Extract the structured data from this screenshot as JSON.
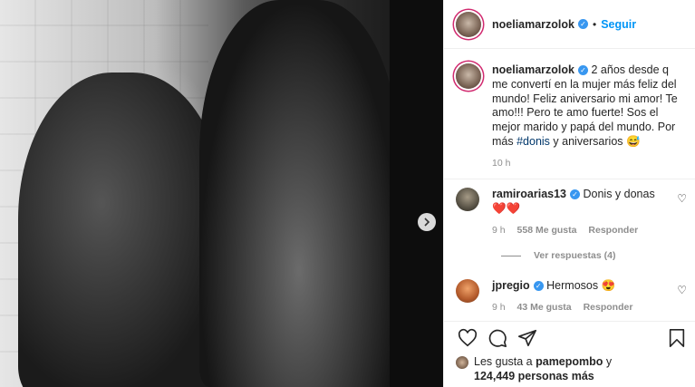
{
  "post": {
    "username": "noeliamarzolok",
    "follow_label": "Seguir",
    "caption_text": "2 años desde q me convertí en la mujer más feliz del mundo! Feliz aniversario mi amor! Te amo!!! Pero te amo fuerte! Sos el mejor marido y papá del mundo. Por más ",
    "caption_hashtag": "#donis",
    "caption_tail": " y aniversarios 😅",
    "time": "10 h"
  },
  "comments": [
    {
      "username": "ramiroarias13",
      "text": "Donis y donas ❤️❤️",
      "time": "9 h",
      "likes": "558 Me gusta",
      "reply_label": "Responder",
      "view_replies": "Ver respuestas (4)"
    },
    {
      "username": "jpregio",
      "text": "Hermosos 😍",
      "time": "9 h",
      "likes": "43 Me gusta",
      "reply_label": "Responder"
    }
  ],
  "likes_line": {
    "prefix": "Les gusta a ",
    "user": "pamepombo",
    "connector": " y",
    "count": "124,449 personas más"
  },
  "icons": {
    "verified": "verified-badge-icon",
    "next": "chevron-right-icon",
    "heart": "heart-icon",
    "comment": "comment-icon",
    "share": "share-icon",
    "save": "bookmark-icon"
  },
  "colors": {
    "accent": "#0095f6",
    "verified": "#3897f0",
    "hashtag": "#00376b",
    "muted": "#8e8e8e",
    "story_ring": "#d12a6f"
  }
}
